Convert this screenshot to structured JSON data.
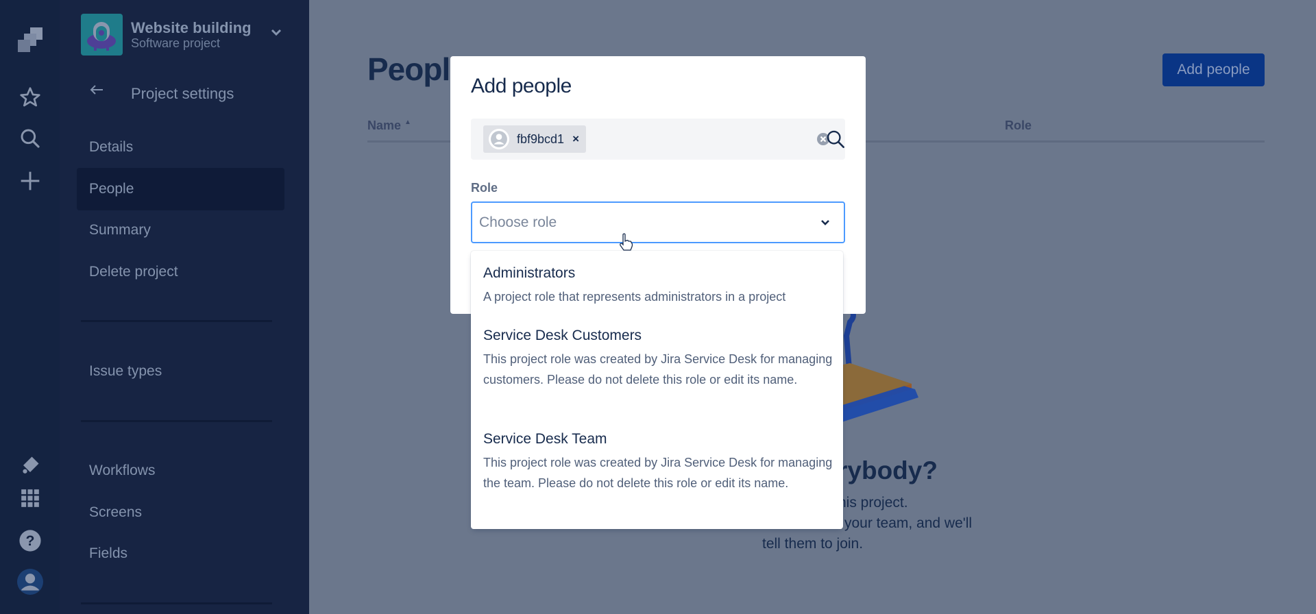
{
  "global_nav": {
    "icons": [
      "jira-logo-icon",
      "star-icon",
      "search-icon",
      "plus-icon",
      "notification-icon",
      "app-switcher-icon",
      "help-icon",
      "profile-avatar-icon"
    ]
  },
  "project": {
    "name": "Website building",
    "type": "Software project"
  },
  "sidebar": {
    "back_label": "Project settings",
    "items": [
      {
        "label": "Details",
        "active": false
      },
      {
        "label": "People",
        "active": true
      },
      {
        "label": "Summary",
        "active": false
      },
      {
        "label": "Delete project",
        "active": false
      },
      {
        "label": "Issue types",
        "active": false
      },
      {
        "label": "Workflows",
        "active": false
      },
      {
        "label": "Screens",
        "active": false
      },
      {
        "label": "Fields",
        "active": false
      }
    ]
  },
  "main": {
    "title": "People",
    "add_people_label": "Add people",
    "columns": {
      "name": "Name",
      "name_sort": "ascending",
      "role": "Role"
    },
    "empty_state": {
      "title_fragment": "rybody?",
      "line1_fragment": "his project.",
      "line2_fragment": "your team, and we'll",
      "line3": "tell them to join."
    }
  },
  "modal": {
    "title": "Add people",
    "selected_users": [
      {
        "name": "fbf9bcd1"
      }
    ],
    "role_label": "Role",
    "role_placeholder": "Choose role",
    "role_options": [
      {
        "title": "Administrators",
        "description": "A project role that represents administrators in a project"
      },
      {
        "title": "Service Desk Customers",
        "description": "This project role was created by Jira Service Desk for managing customers. Please do not delete this role or edit its name."
      },
      {
        "title": "Service Desk Team",
        "description": "This project role was created by Jira Service Desk for managing the team. Please do not delete this role or edit its name."
      }
    ]
  },
  "colors": {
    "focus_border": "#4c9aff",
    "primary_button": "#0052cc",
    "nav_bg": "#0747a6",
    "text_dark": "#172b4d"
  }
}
